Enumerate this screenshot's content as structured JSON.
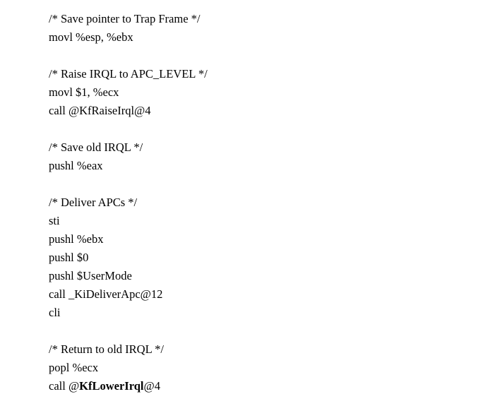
{
  "listing": {
    "lines": [
      {
        "segments": [
          {
            "text": "/* Save pointer to Trap Frame */"
          }
        ]
      },
      {
        "segments": [
          {
            "text": "movl %esp, %ebx"
          }
        ]
      },
      {
        "segments": []
      },
      {
        "segments": [
          {
            "text": "/* Raise IRQL to APC_LEVEL */"
          }
        ]
      },
      {
        "segments": [
          {
            "text": "movl $1, %ecx"
          }
        ]
      },
      {
        "segments": [
          {
            "text": "call @KfRaiseIrql@4"
          }
        ]
      },
      {
        "segments": []
      },
      {
        "segments": [
          {
            "text": "/* Save old IRQL */"
          }
        ]
      },
      {
        "segments": [
          {
            "text": "pushl %eax"
          }
        ]
      },
      {
        "segments": []
      },
      {
        "segments": [
          {
            "text": "/* Deliver APCs */"
          }
        ]
      },
      {
        "segments": [
          {
            "text": "sti"
          }
        ]
      },
      {
        "segments": [
          {
            "text": "pushl %ebx"
          }
        ]
      },
      {
        "segments": [
          {
            "text": "pushl $0"
          }
        ]
      },
      {
        "segments": [
          {
            "text": "pushl $UserMode"
          }
        ]
      },
      {
        "segments": [
          {
            "text": "call _KiDeliverApc@12"
          }
        ]
      },
      {
        "segments": [
          {
            "text": "cli"
          }
        ]
      },
      {
        "segments": []
      },
      {
        "segments": [
          {
            "text": "/* Return to old IRQL */"
          }
        ]
      },
      {
        "segments": [
          {
            "text": "popl %ecx"
          }
        ]
      },
      {
        "segments": [
          {
            "text": "call @"
          },
          {
            "text": "KfLowerIrql",
            "bold": true
          },
          {
            "text": "@4"
          }
        ]
      }
    ]
  }
}
